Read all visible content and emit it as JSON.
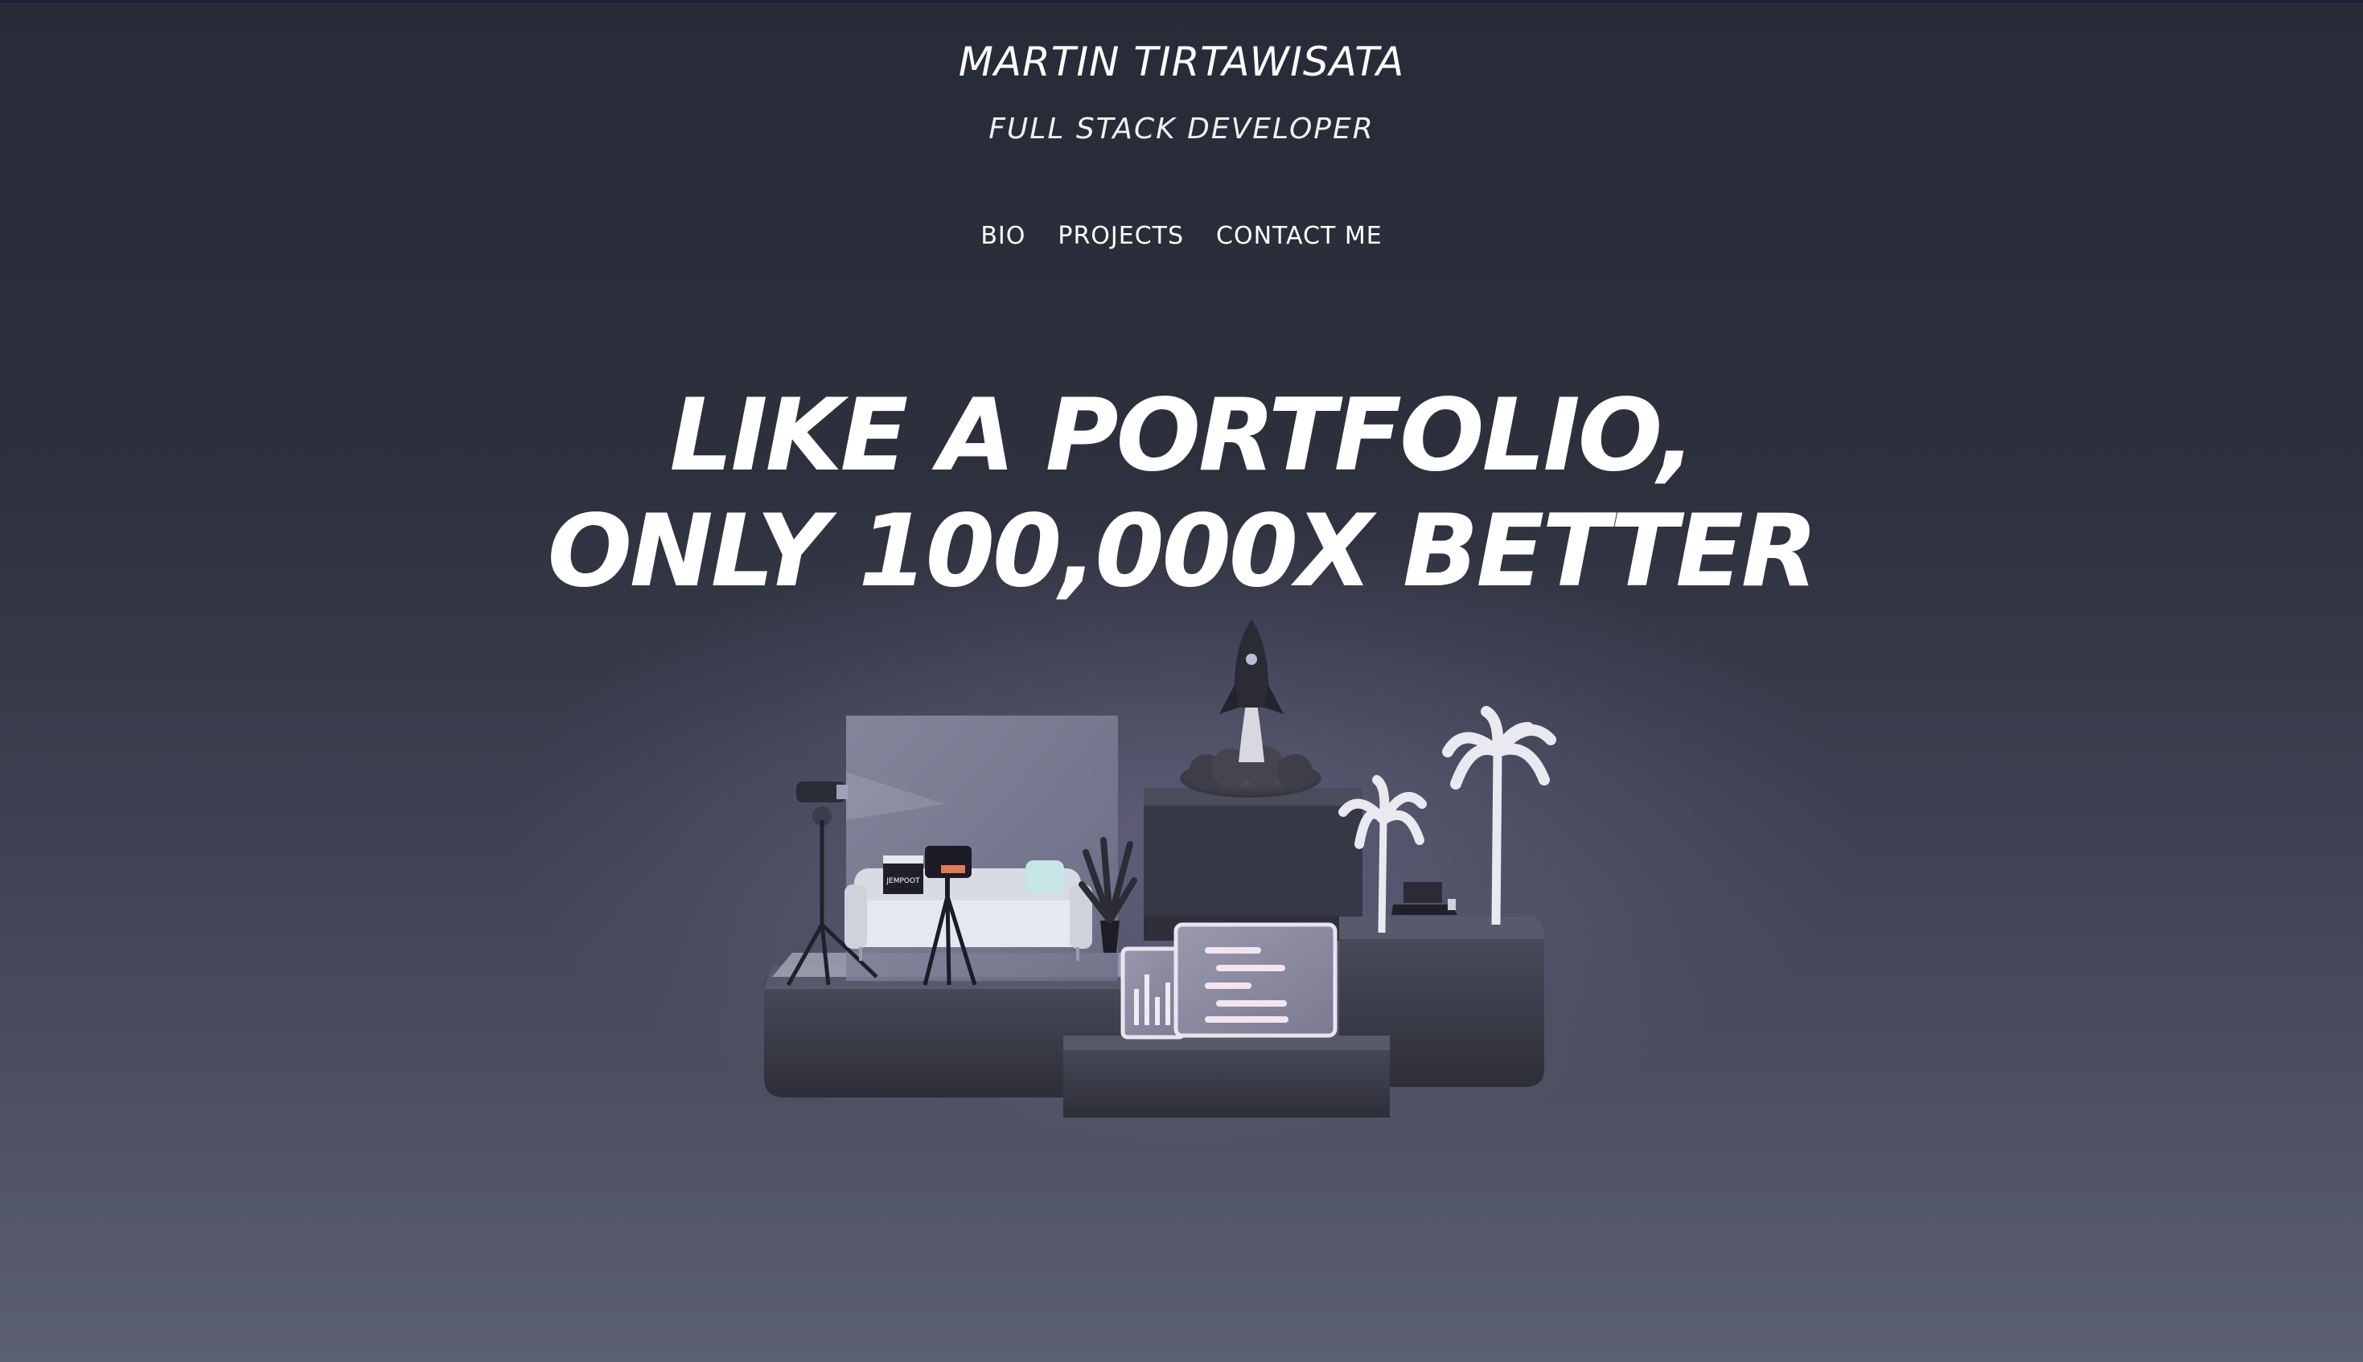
{
  "header": {
    "name": "MARTIN TIRTAWISATA",
    "role": "FULL STACK DEVELOPER"
  },
  "nav": {
    "items": [
      {
        "label": "BIO"
      },
      {
        "label": "PROJECTS"
      },
      {
        "label": "CONTACT ME"
      }
    ]
  },
  "hero": {
    "line1": "LIKE A PORTFOLIO,",
    "line2": "ONLY 100,000X BETTER"
  },
  "illustration": {
    "clapperboard_text": "JEMPOOT",
    "items": [
      "camera-on-tripod",
      "studio-light",
      "sofa",
      "potted-plant",
      "rocket-launch",
      "palm-trees",
      "laptop",
      "bar-chart-card",
      "text-lines-card"
    ]
  },
  "colors": {
    "background_top": "#272b37",
    "background_bottom": "#5b6072",
    "text": "#ffffff",
    "platform": "#3a3b48"
  }
}
